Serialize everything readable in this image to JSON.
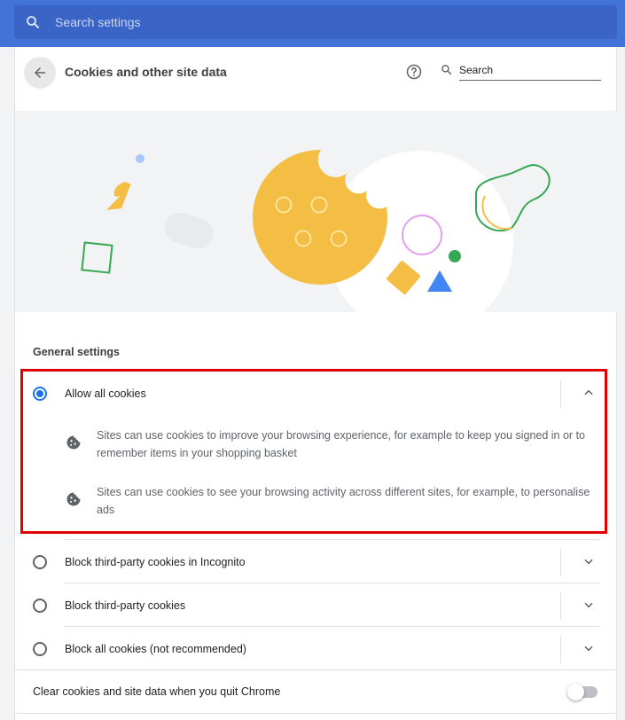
{
  "topbar": {
    "search_placeholder": "Search settings"
  },
  "header": {
    "title": "Cookies and other site data",
    "search_placeholder": "Search"
  },
  "general": {
    "section_title": "General settings",
    "options": [
      {
        "label": "Allow all cookies",
        "selected": true,
        "expanded": true
      },
      {
        "label": "Block third-party cookies in Incognito",
        "selected": false,
        "expanded": false
      },
      {
        "label": "Block third-party cookies",
        "selected": false,
        "expanded": false
      },
      {
        "label": "Block all cookies (not recommended)",
        "selected": false,
        "expanded": false
      }
    ],
    "allow_details": [
      "Sites can use cookies to improve your browsing experience, for example to keep you signed in or to remember items in your shopping basket",
      "Sites can use cookies to see your browsing activity across different sites, for example, to personalise ads"
    ]
  },
  "clear_on_exit": {
    "label": "Clear cookies and site data when you quit Chrome",
    "enabled": false
  },
  "colors": {
    "topbar": "#4373d6",
    "accent": "#1a73e8",
    "highlight": "#e00000",
    "cookie": "#f4be45"
  }
}
